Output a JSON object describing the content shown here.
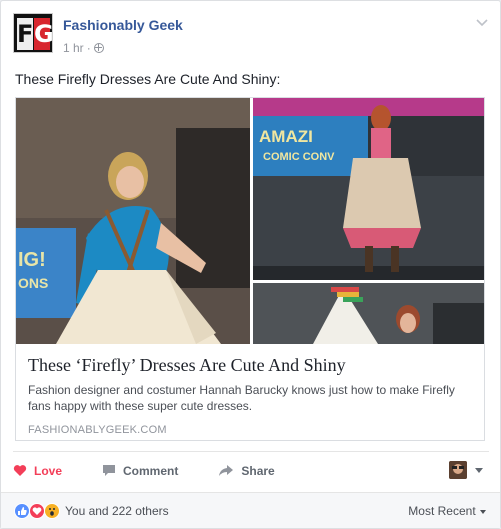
{
  "post": {
    "page_name": "Fashionably Geek",
    "time": "1 hr",
    "separator": "·",
    "text": "These Firefly Dresses Are Cute And Shiny:",
    "logo_letters": [
      "F",
      "G"
    ]
  },
  "link": {
    "title": "These ‘Firefly’ Dresses Are Cute And Shiny",
    "description": "Fashion designer and costumer Hannah Barucky knows just how to make Firefly fans happy with these super cute dresses.",
    "domain": "FASHIONABLYGEEK.COM",
    "image_signs": [
      "AMAZI",
      "COMIC CONV",
      "IG!",
      "ONS"
    ]
  },
  "actions": {
    "love": "Love",
    "comment": "Comment",
    "share": "Share"
  },
  "reactions": {
    "summary": "You and 222 others",
    "sort": "Most Recent"
  },
  "colors": {
    "link_blue": "#365899",
    "love_red": "#f33e58",
    "like_blue": "#5890ff",
    "wow_yellow": "#f7b125"
  }
}
